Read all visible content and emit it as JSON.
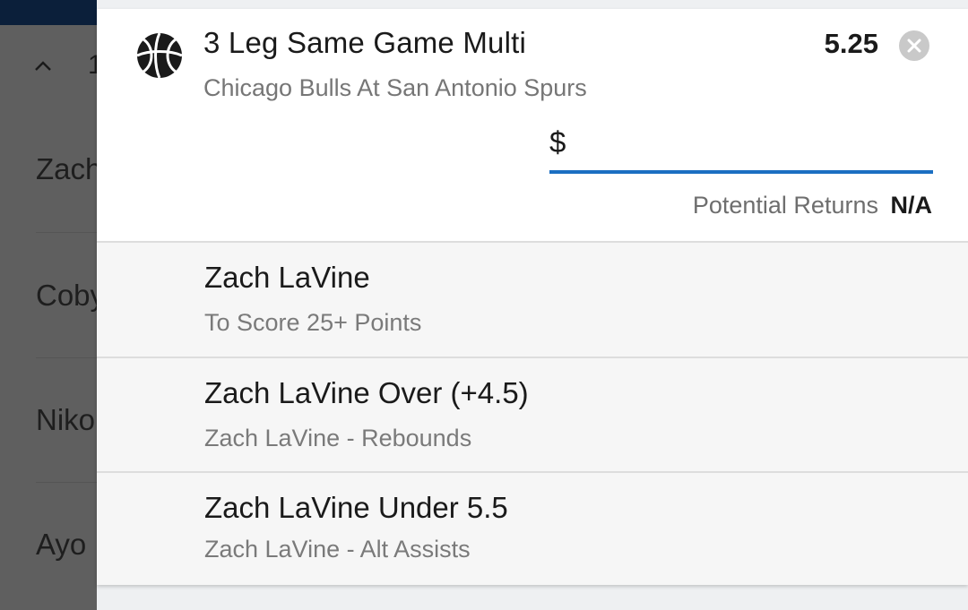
{
  "background": {
    "chevron_icon": "chevron-up-icon",
    "partial_number": "1",
    "rows": [
      "Zach",
      "Coby",
      "Niko",
      "Ayo"
    ]
  },
  "betslip": {
    "sport_icon": "basketball-icon",
    "title": "3 Leg Same Game Multi",
    "subtitle": "Chicago Bulls At San Antonio Spurs",
    "odds": "5.25",
    "close_icon": "close-circle-icon",
    "stake": {
      "currency_symbol": "$",
      "value": "",
      "placeholder": ""
    },
    "potential_returns_label": "Potential Returns",
    "potential_returns_value": "N/A",
    "legs": [
      {
        "name": "Zach LaVine",
        "detail": "To Score 25+ Points"
      },
      {
        "name": "Zach LaVine Over (+4.5)",
        "detail": "Zach LaVine - Rebounds"
      },
      {
        "name": "Zach LaVine Under 5.5",
        "detail": "Zach LaVine - Alt Assists"
      }
    ]
  },
  "colors": {
    "accent": "#1b6fc2",
    "overlay": "#5f5f5f",
    "topbar": "#0b1f3a"
  }
}
